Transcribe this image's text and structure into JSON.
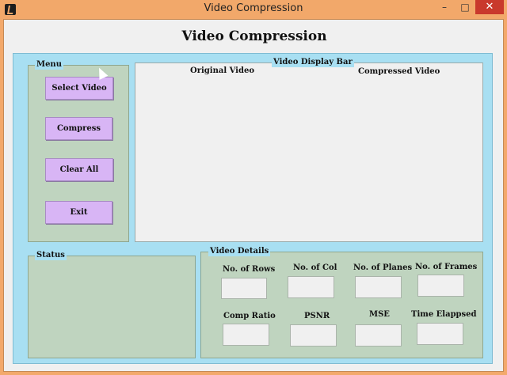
{
  "window": {
    "title": "Video Compression",
    "minimize_icon": "minimize-icon",
    "maximize_icon": "maximize-icon",
    "close_icon": "close-icon",
    "min_glyph": "–",
    "max_glyph": "□",
    "close_glyph": "✕"
  },
  "app": {
    "heading": "Video Compression"
  },
  "menu": {
    "label": "Menu",
    "buttons": {
      "select": "Select Video",
      "compress": "Compress",
      "clear": "Clear All",
      "exit": "Exit"
    }
  },
  "display": {
    "label": "Video Display Bar",
    "original": "Original Video",
    "compressed": "Compressed Video"
  },
  "status": {
    "label": "Status"
  },
  "details": {
    "label": "Video Details",
    "rows": "No. of Rows",
    "cols": "No. of Col",
    "planes": "No. of Planes",
    "frames": "No. of Frames",
    "ratio": "Comp Ratio",
    "psnr": "PSNR",
    "mse": "MSE",
    "time": "Time Elappsed",
    "values": {
      "rows": "",
      "cols": "",
      "planes": "",
      "frames": "",
      "ratio": "",
      "psnr": "",
      "mse": "",
      "time": ""
    }
  }
}
